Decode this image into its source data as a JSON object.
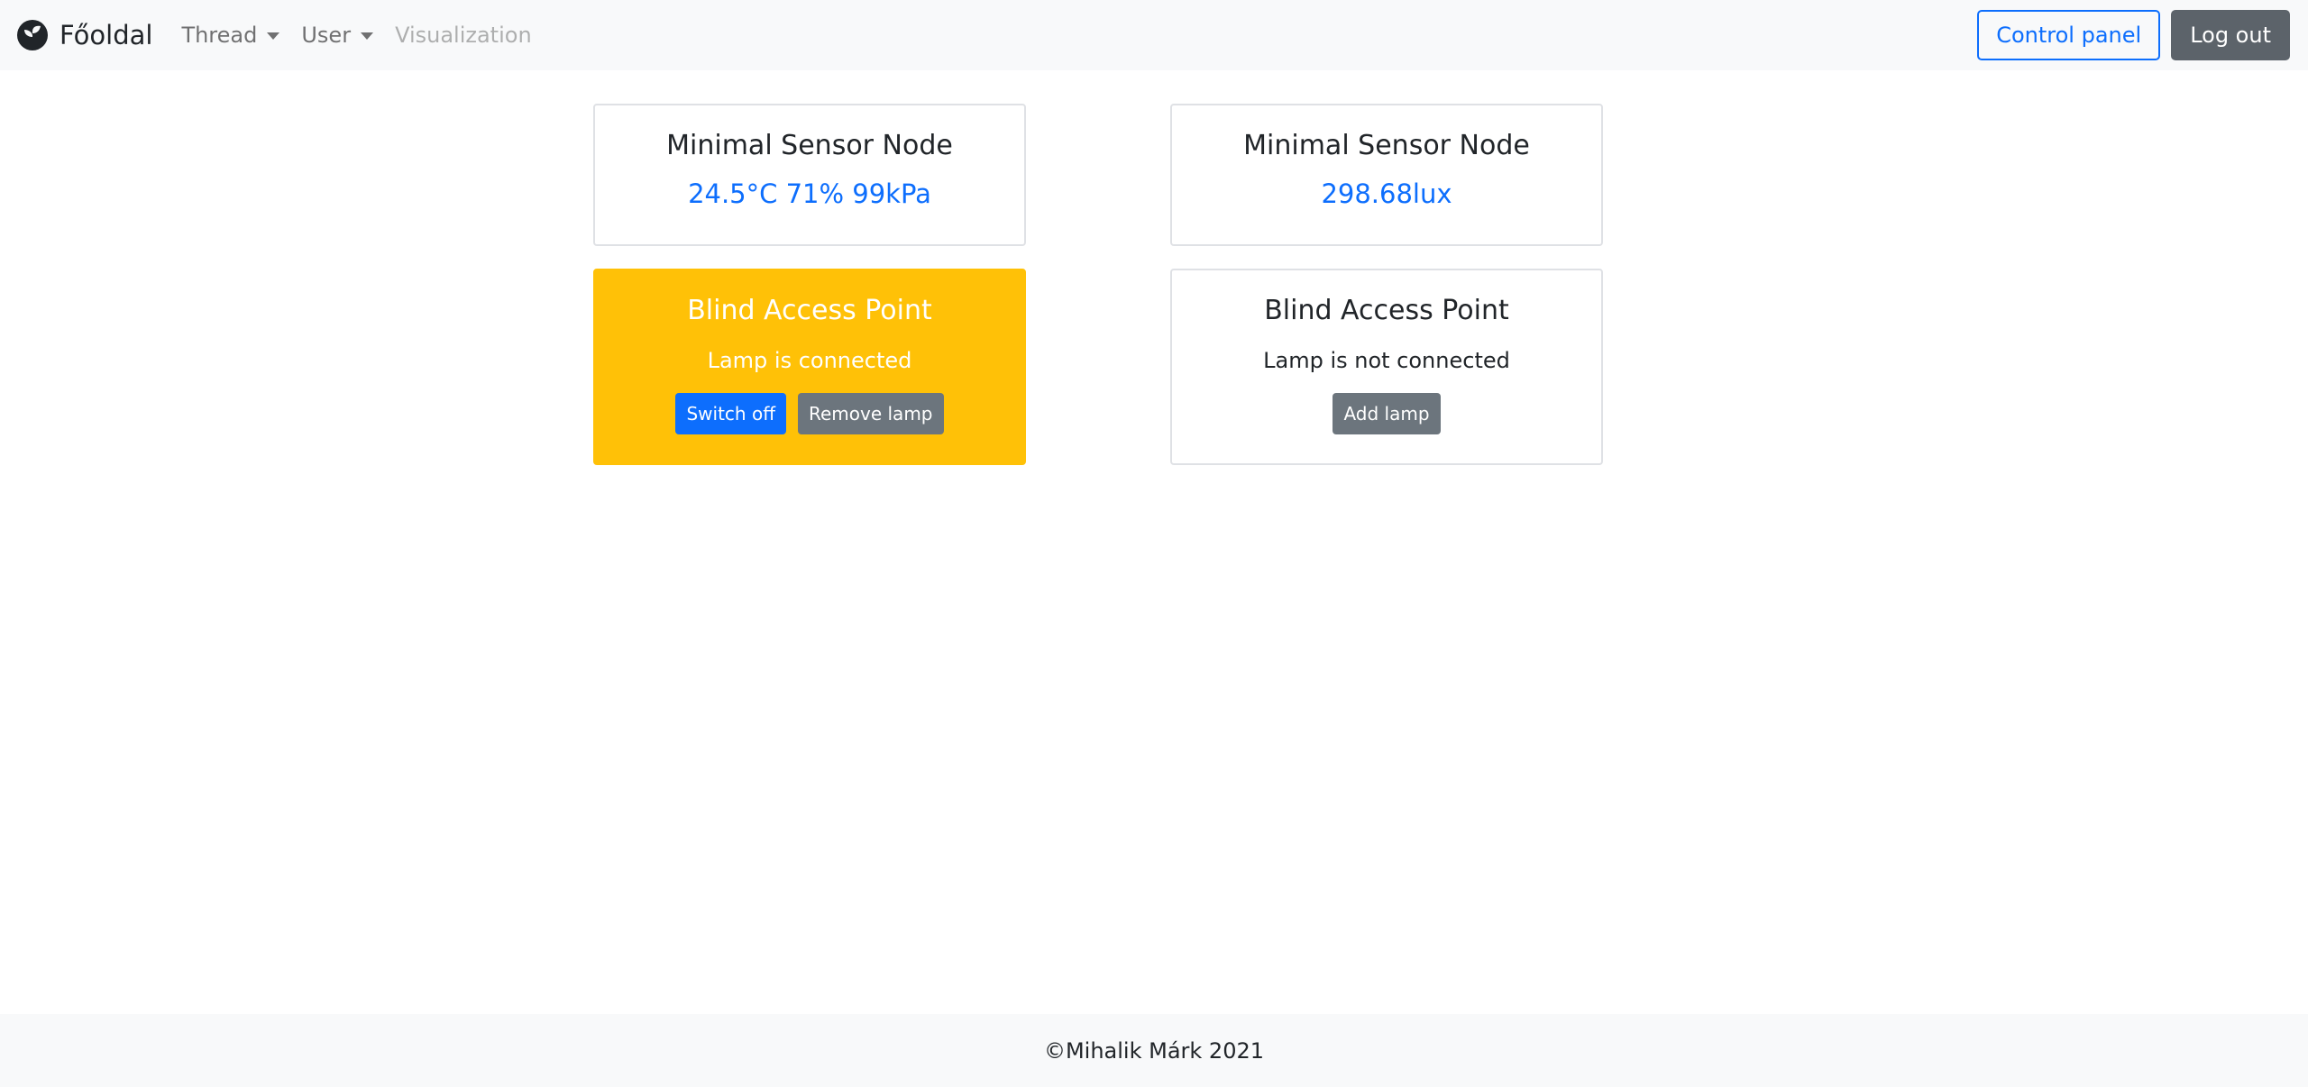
{
  "navbar": {
    "brand": "Főoldal",
    "brand_icon": "leaf-logo-icon",
    "items": [
      {
        "label": "Thread",
        "dropdown": true
      },
      {
        "label": "User",
        "dropdown": true
      },
      {
        "label": "Visualization",
        "disabled": true
      }
    ],
    "control_panel_label": "Control panel",
    "logout_label": "Log out"
  },
  "cards": {
    "sensor1": {
      "title": "Minimal Sensor Node",
      "value": "24.5°C 71% 99kPa"
    },
    "sensor2": {
      "title": "Minimal Sensor Node",
      "value": "298.68lux"
    },
    "ap1": {
      "title": "Blind Access Point",
      "status": "Lamp is connected",
      "switch_label": "Switch off",
      "remove_label": "Remove lamp",
      "highlight_color": "#ffc107"
    },
    "ap2": {
      "title": "Blind Access Point",
      "status": "Lamp is not connected",
      "add_label": "Add lamp"
    }
  },
  "footer": {
    "text": "©Mihalik Márk 2021"
  },
  "colors": {
    "primary": "#0d6efd",
    "secondary": "#6c757d",
    "warning": "#ffc107",
    "navbar_bg": "#f8f9fa"
  }
}
